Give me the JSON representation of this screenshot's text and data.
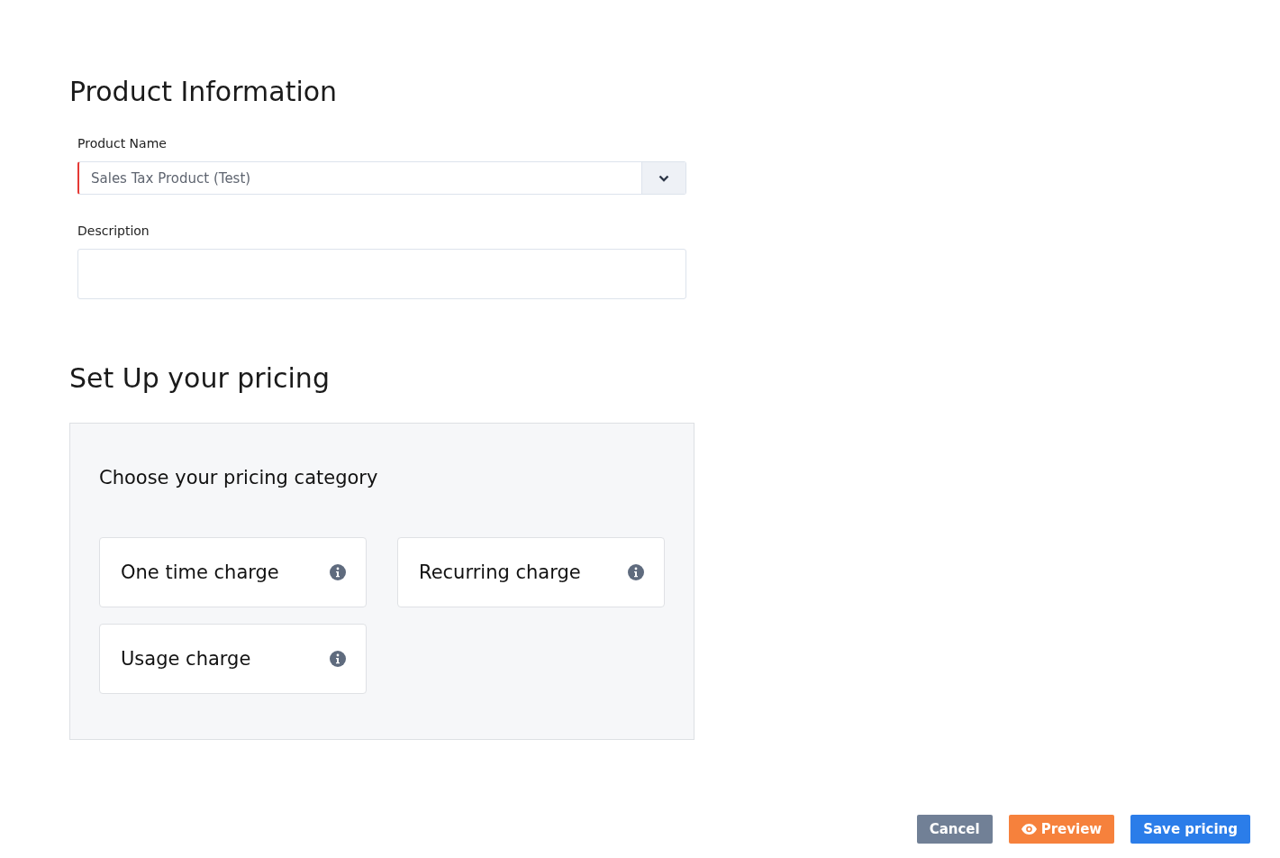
{
  "product_information": {
    "title": "Product Information",
    "product_name": {
      "label": "Product Name",
      "value": "Sales Tax Product (Test)",
      "invalid": true
    },
    "description": {
      "label": "Description"
    }
  },
  "pricing": {
    "title": "Set Up your pricing",
    "panel_title": "Choose your pricing category",
    "categories": [
      {
        "label": "One time charge"
      },
      {
        "label": "Recurring charge"
      },
      {
        "label": "Usage charge"
      }
    ]
  },
  "buttons": [
    {
      "label": "Cancel",
      "kind": "cancel"
    },
    {
      "label": "Preview",
      "kind": "preview"
    },
    {
      "label": "Save pricing",
      "kind": "save"
    }
  ]
}
